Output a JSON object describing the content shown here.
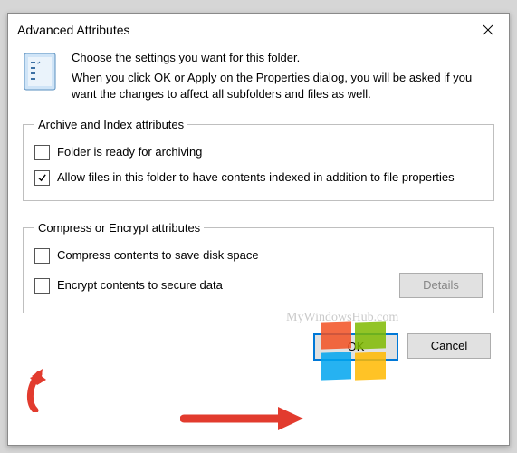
{
  "window": {
    "title": "Advanced Attributes"
  },
  "intro": {
    "line1": "Choose the settings you want for this folder.",
    "line2": "When you click OK or Apply on the Properties dialog, you will be asked if you want the changes to affect all subfolders and files as well."
  },
  "group1": {
    "legend": "Archive and Index attributes",
    "opt1": {
      "label": "Folder is ready for archiving",
      "checked": false
    },
    "opt2": {
      "label": "Allow files in this folder to have contents indexed in addition to file properties",
      "checked": true
    }
  },
  "group2": {
    "legend": "Compress or Encrypt attributes",
    "opt1": {
      "label": "Compress contents to save disk space",
      "checked": false
    },
    "opt2": {
      "label": "Encrypt contents to secure data",
      "checked": false
    },
    "details_label": "Details"
  },
  "buttons": {
    "ok": "OK",
    "cancel": "Cancel"
  },
  "watermark": "MyWindowsHub.com"
}
